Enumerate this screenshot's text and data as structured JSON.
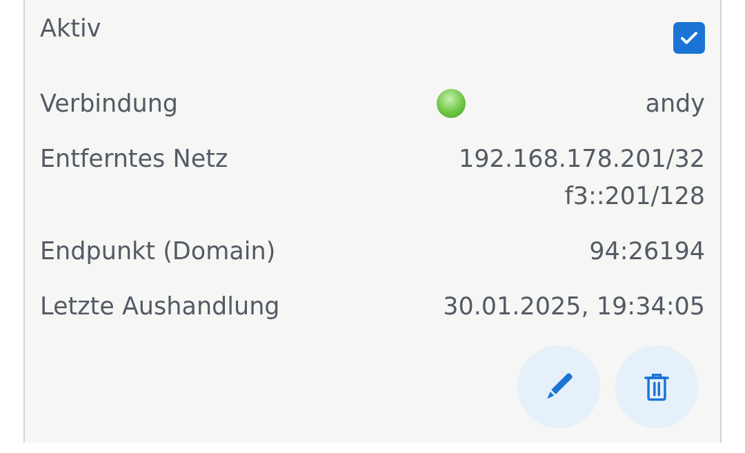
{
  "active": {
    "label": "Aktiv",
    "checked": true
  },
  "rows": [
    {
      "label": "Verbindung",
      "kind": "status",
      "connected": true,
      "values": [
        "andy"
      ]
    },
    {
      "label": "Entferntes Netz",
      "kind": "text",
      "values": [
        "192.168.178.201/32",
        "f3::201/128"
      ]
    },
    {
      "label": "Endpunkt (Domain)",
      "kind": "text",
      "values": [
        "94:26194"
      ]
    },
    {
      "label": "Letzte Aushandlung",
      "kind": "text",
      "values": [
        "30.01.2025, 19:34:05"
      ]
    }
  ]
}
